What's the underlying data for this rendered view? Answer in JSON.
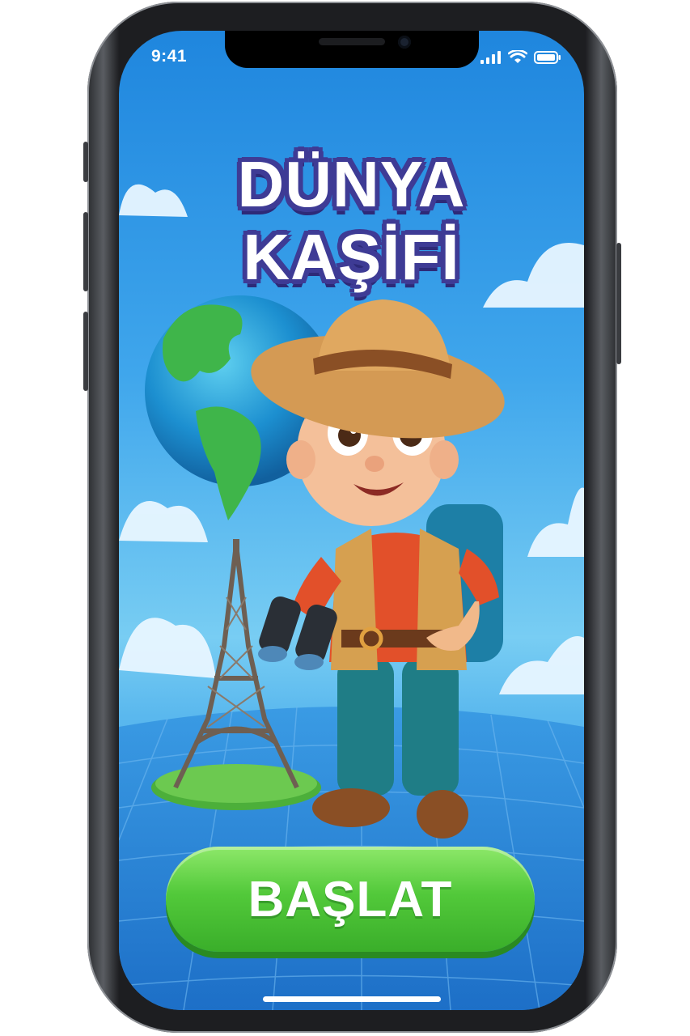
{
  "status_bar": {
    "time": "9:41"
  },
  "title": {
    "line1": "DÜNYA",
    "line2": "KAŞİFİ"
  },
  "start_button": {
    "label": "BAŞLAT"
  },
  "colors": {
    "sky_top": "#1f86de",
    "title_outline": "#3e3b95",
    "button_green": "#52c93a"
  },
  "icons": [
    "cellular-signal-icon",
    "wifi-icon",
    "battery-icon"
  ]
}
